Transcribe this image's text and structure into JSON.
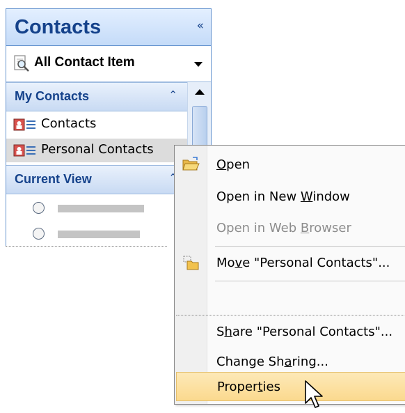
{
  "nav_pane": {
    "title": "Contacts",
    "view_selector": {
      "label": "All Contact Item"
    },
    "my_contacts": {
      "title": "My Contacts",
      "items": [
        {
          "label": "Contacts"
        },
        {
          "label": "Personal Contacts",
          "selected": true
        }
      ]
    },
    "current_view": {
      "title": "Current View",
      "options": [
        {
          "checked": false
        },
        {
          "checked": false
        }
      ]
    }
  },
  "context_menu": {
    "items": [
      {
        "label_pre": "",
        "label_key": "O",
        "label_post": "pen",
        "icon": "open-folder-icon",
        "enabled": true
      },
      {
        "label_pre": "Open in New ",
        "label_key": "W",
        "label_post": "indow",
        "enabled": true
      },
      {
        "label_pre": "Open in Web ",
        "label_key": "B",
        "label_post": "rowser",
        "enabled": false
      },
      {
        "label_pre": "Mo",
        "label_key": "v",
        "label_post": "e \"Personal Contacts\"...",
        "icon": "move-folder-icon",
        "enabled": true
      },
      {
        "label_pre": "S",
        "label_key": "h",
        "label_post": "are \"Personal Contacts\"...",
        "enabled": true
      },
      {
        "label_pre": "Change Sh",
        "label_key": "a",
        "label_post": "ring...",
        "enabled": true
      },
      {
        "label_pre": "Proper",
        "label_key": "t",
        "label_post": "ies",
        "enabled": true,
        "highlighted": true
      }
    ]
  },
  "colors": {
    "header_text": "#15428b",
    "highlight": "#fbd98e",
    "selected_row": "#dcdcdc",
    "disabled_text": "#8d8d8d"
  }
}
